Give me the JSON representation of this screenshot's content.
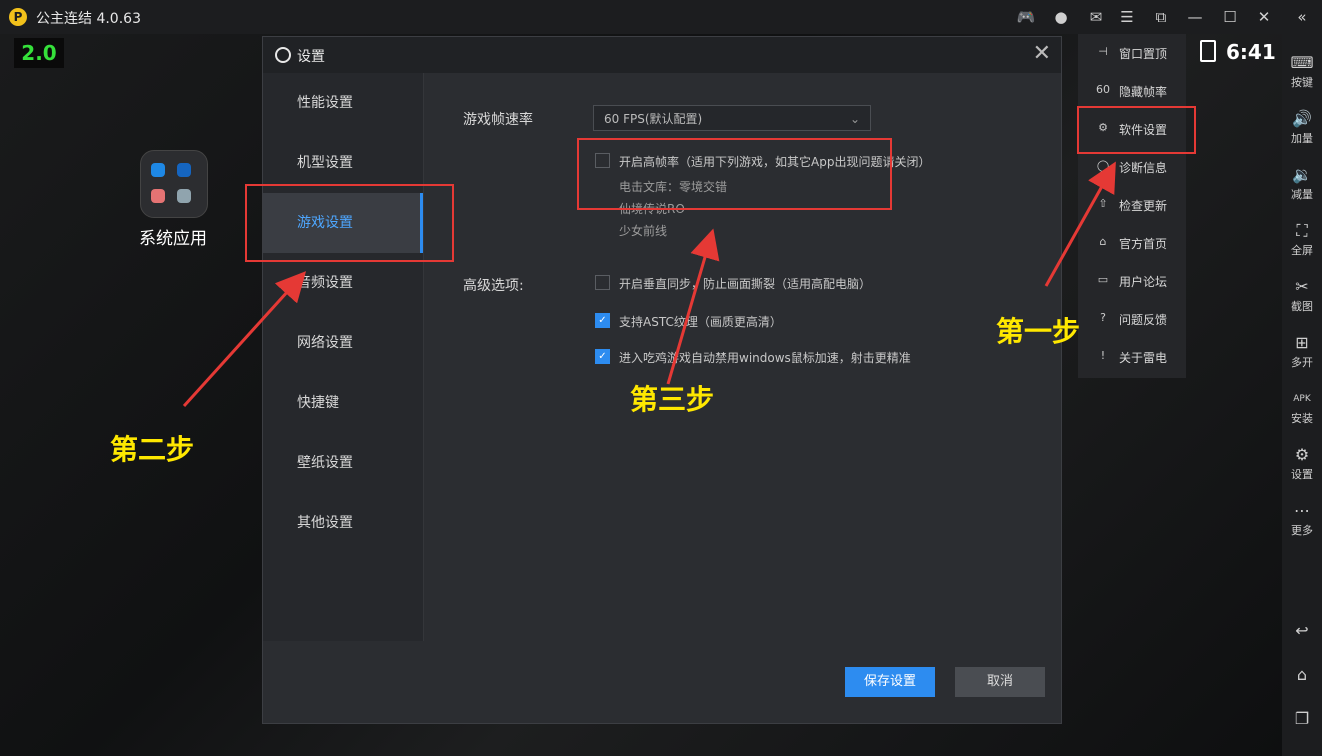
{
  "app": {
    "title": "公主连结 4.0.63"
  },
  "fps_overlay": "2.0",
  "desktop": {
    "system_app_label": "系统应用"
  },
  "dialog": {
    "title": "设置",
    "nav": [
      "性能设置",
      "机型设置",
      "游戏设置",
      "音频设置",
      "网络设置",
      "快捷键",
      "壁纸设置",
      "其他设置"
    ],
    "active_nav": "游戏设置",
    "fps_label": "游戏帧速率",
    "fps_value": "60 FPS(默认配置)",
    "high_fps_option": "开启高帧率（适用下列游戏，如其它App出现问题请关闭）",
    "high_fps_games": [
      "电击文库：零境交错",
      "仙境传说RO",
      "少女前线"
    ],
    "advanced_label": "高级选项:",
    "advanced_options": [
      {
        "label": "开启垂直同步，防止画面撕裂（适用高配电脑）",
        "checked": false
      },
      {
        "label": "支持ASTC纹理（画质更高清）",
        "checked": true
      },
      {
        "label": "进入吃鸡游戏自动禁用windows鼠标加速，射击更精准",
        "checked": true
      }
    ],
    "save_button": "保存设置",
    "cancel_button": "取消"
  },
  "menu": [
    {
      "icon": "pin-icon",
      "label": "窗口置顶"
    },
    {
      "icon": "fps-icon",
      "label": "隐藏帧率"
    },
    {
      "icon": "gear-icon",
      "label": "软件设置"
    },
    {
      "icon": "diagnose-icon",
      "label": "诊断信息"
    },
    {
      "icon": "upload-icon",
      "label": "检查更新"
    },
    {
      "icon": "home-icon",
      "label": "官方首页"
    },
    {
      "icon": "forum-icon",
      "label": "用户论坛"
    },
    {
      "icon": "question-icon",
      "label": "问题反馈"
    },
    {
      "icon": "info-icon",
      "label": "关于雷电"
    }
  ],
  "status": {
    "clock": "6:41"
  },
  "sidebar": [
    {
      "icon": "keyboard-icon",
      "label": "按键"
    },
    {
      "icon": "volume-up-icon",
      "label": "加量"
    },
    {
      "icon": "volume-down-icon",
      "label": "减量"
    },
    {
      "icon": "fullscreen-icon",
      "label": "全屏"
    },
    {
      "icon": "scissors-icon",
      "label": "截图"
    },
    {
      "icon": "multi-open-icon",
      "label": "多开"
    },
    {
      "icon": "apk-icon",
      "label": "安装"
    },
    {
      "icon": "settings-icon",
      "label": "设置"
    },
    {
      "icon": "more-icon",
      "label": "更多"
    }
  ],
  "annotations": {
    "step1": "第一步",
    "step2": "第二步",
    "step3": "第三步"
  },
  "colors": {
    "accent": "#2d8cf0",
    "highlight_box": "#e53935",
    "annotation": "#ffe800",
    "fps_green": "#35e03a"
  }
}
